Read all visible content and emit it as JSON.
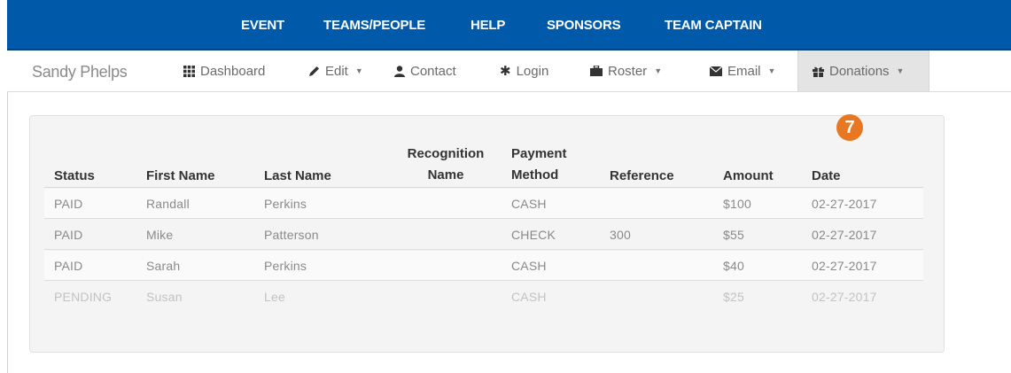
{
  "top_nav": {
    "items": [
      "EVENT",
      "TEAMS/PEOPLE",
      "HELP",
      "SPONSORS",
      "TEAM CAPTAIN"
    ]
  },
  "sub_nav": {
    "brand": "Sandy Phelps",
    "items": [
      {
        "label": "Dashboard",
        "icon": "grid-icon",
        "caret": false
      },
      {
        "label": "Edit",
        "icon": "pencil-icon",
        "caret": true
      },
      {
        "label": "Contact",
        "icon": "user-icon",
        "caret": false
      },
      {
        "label": "Login",
        "icon": "asterisk-icon",
        "caret": false
      },
      {
        "label": "Roster",
        "icon": "briefcase-icon",
        "caret": true
      },
      {
        "label": "Email",
        "icon": "envelope-icon",
        "caret": true
      },
      {
        "label": "Donations",
        "icon": "gift-icon",
        "caret": true,
        "active": true
      }
    ]
  },
  "step_badge": "7",
  "table": {
    "columns": [
      [
        "Status"
      ],
      [
        "First Name"
      ],
      [
        "Last Name"
      ],
      [
        "Recognition",
        "Name"
      ],
      [
        "Payment",
        "Method"
      ],
      [
        "Reference"
      ],
      [
        "Amount"
      ],
      [
        "Date"
      ]
    ],
    "rows": [
      {
        "status": "PAID",
        "first": "Randall",
        "last": "Perkins",
        "recognition": "",
        "method": "CASH",
        "reference": "",
        "amount": "$100",
        "date": "02-27-2017"
      },
      {
        "status": "PAID",
        "first": "Mike",
        "last": "Patterson",
        "recognition": "",
        "method": "CHECK",
        "reference": "300",
        "amount": "$55",
        "date": "02-27-2017"
      },
      {
        "status": "PAID",
        "first": "Sarah",
        "last": "Perkins",
        "recognition": "",
        "method": "CASH",
        "reference": "",
        "amount": "$40",
        "date": "02-27-2017"
      },
      {
        "status": "PENDING",
        "first": "Susan",
        "last": "Lee",
        "recognition": "",
        "method": "CASH",
        "reference": "",
        "amount": "$25",
        "date": "02-27-2017"
      }
    ]
  },
  "colors": {
    "top_nav_bg": "#005aa9",
    "badge_bg": "#e87722",
    "panel_bg": "#f4f4f4",
    "active_tab_bg": "#e4e4e4"
  }
}
